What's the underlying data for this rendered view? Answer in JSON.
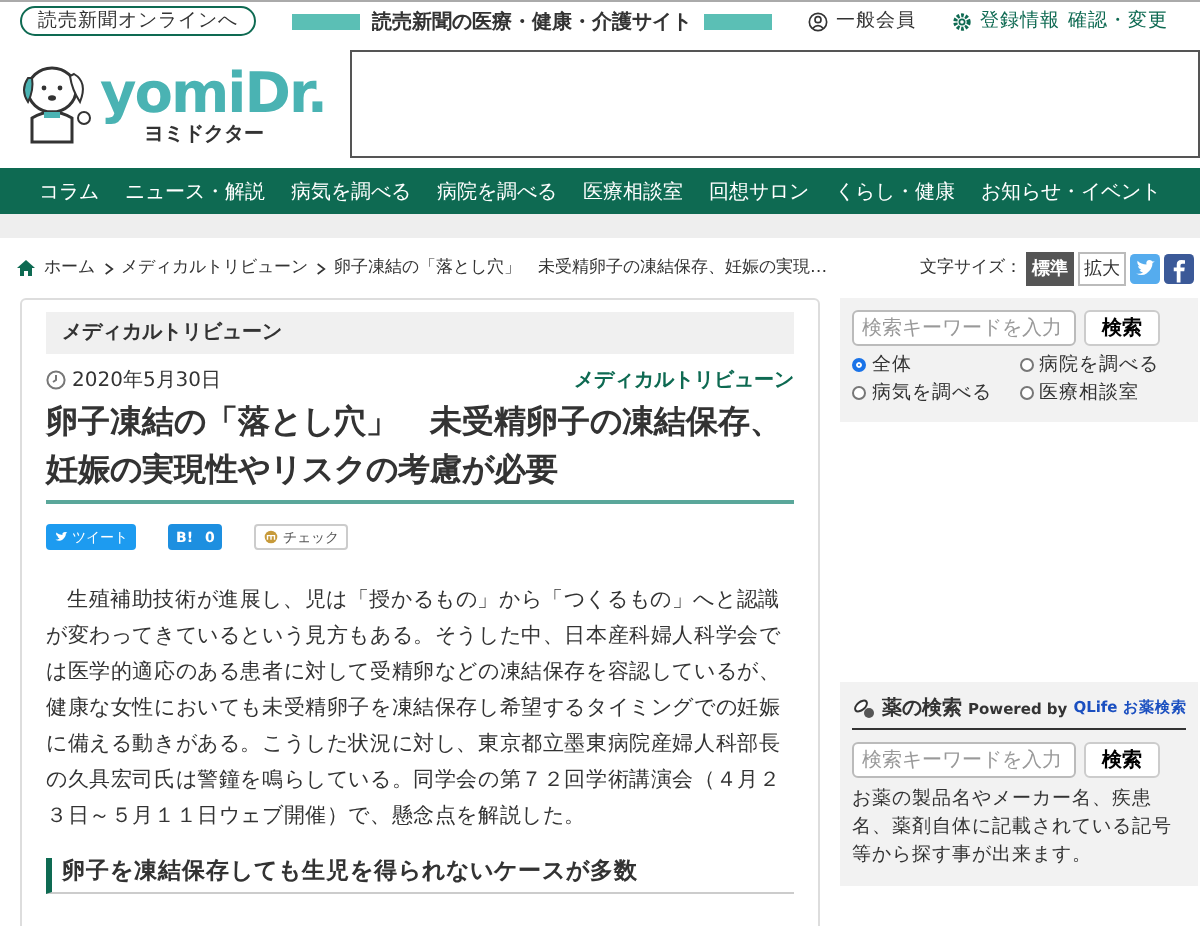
{
  "top_bar": {
    "online_link": "読売新聞オンラインへ",
    "site_tagline": "読売新聞の医療・健康・介護サイト",
    "member": "一般会員",
    "settings": "登録情報",
    "settings_link": "確認・変更"
  },
  "logo": {
    "name": "yomiDr.",
    "kana": "ヨミドクター"
  },
  "nav": [
    "コラム",
    "ニュース・解説",
    "病気を調べる",
    "病院を調べる",
    "医療相談室",
    "回想サロン",
    "くらし・健康",
    "お知らせ・イベント"
  ],
  "breadcrumb": [
    "ホーム",
    "メディカルトリビューン",
    "卵子凍結の「落とし穴」　未受精卵子の凍結保存、妊娠の実現…"
  ],
  "font_size": {
    "label": "文字サイズ：",
    "options": [
      {
        "label": "標準",
        "selected": true
      },
      {
        "label": "拡大",
        "selected": false
      }
    ]
  },
  "article": {
    "category": "メディカルトリビューン",
    "date": "2020年5月30日",
    "source": "メディカルトリビューン",
    "title": "卵子凍結の「落とし穴」　未受精卵子の凍結保存、妊娠の実現性やリスクの考慮が必要",
    "share": [
      {
        "kind": "tweet",
        "label": "ツイート"
      },
      {
        "kind": "hatena",
        "label": "B!",
        "count": "0"
      },
      {
        "kind": "check",
        "label": "チェック"
      }
    ],
    "body": "生殖補助技術が進展し、児は「授かるもの」から「つくるもの」へと認識が変わってきているという見方もある。そうした中、日本産科婦人科学会では医学的適応のある患者に対して受精卵などの凍結保存を容認しているが、健康な女性においても未受精卵子を凍結保存し希望するタイミングでの妊娠に備える動きがある。こうした状況に対し、東京都立墨東病院産婦人科部長の久具宏司氏は警鐘を鳴らしている。同学会の第７２回学術講演会（４月２３日～５月１１日ウェブ開催）で、懸念点を解説した。",
    "subheading": "卵子を凍結保存しても生児を得られないケースが多数"
  },
  "site_search": {
    "placeholder": "検索キーワードを入力",
    "button": "検索",
    "scopes": [
      {
        "label": "全体",
        "selected": true
      },
      {
        "label": "病院を調べる",
        "selected": false
      },
      {
        "label": "病気を調べる",
        "selected": false
      },
      {
        "label": "医療相談室",
        "selected": false
      }
    ]
  },
  "drug_search": {
    "title": "薬の検索",
    "powered": "Powered by",
    "provider": "QLife お薬検索",
    "placeholder": "検索キーワードを入力",
    "button": "検索",
    "description": "お薬の製品名やメーカー名、疾患名、薬剤自体に記載されている記号等から探す事が出来ます。"
  }
}
